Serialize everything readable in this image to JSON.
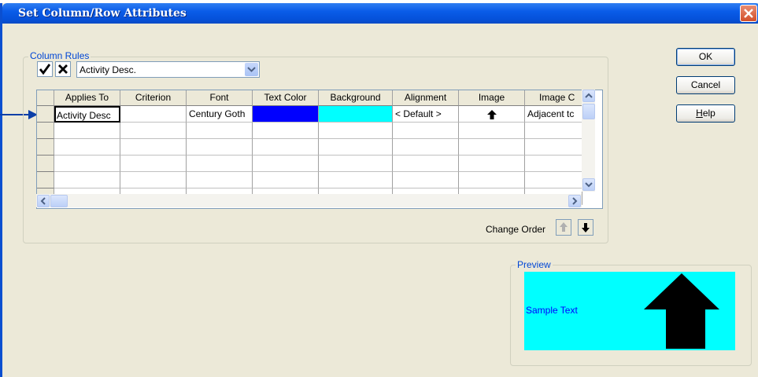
{
  "window": {
    "title": "Set Column/Row Attributes"
  },
  "column_rules": {
    "group_label": "Column Rules",
    "selector_value": "Activity Desc.",
    "grid": {
      "columns": [
        "Applies To",
        "Criterion",
        "Font",
        "Text Color",
        "Background",
        "Alignment",
        "Image",
        "Image C"
      ],
      "rows": [
        {
          "applies_to": "Activity Desc",
          "criterion": "",
          "font": "Century Goth",
          "text_color": "#0000ff",
          "background": "#00ffff",
          "alignment": "< Default >",
          "image": "up-arrow-icon",
          "image_c": "Adjacent tc"
        }
      ],
      "empty_row_count": 5
    },
    "change_order_label": "Change Order"
  },
  "buttons": {
    "ok": "OK",
    "cancel": "Cancel",
    "help_underlined": "H",
    "help_rest": "elp"
  },
  "preview": {
    "group_label": "Preview",
    "sample_text": "Sample Text",
    "background_color": "#00ffff",
    "text_color": "#0000ff"
  }
}
